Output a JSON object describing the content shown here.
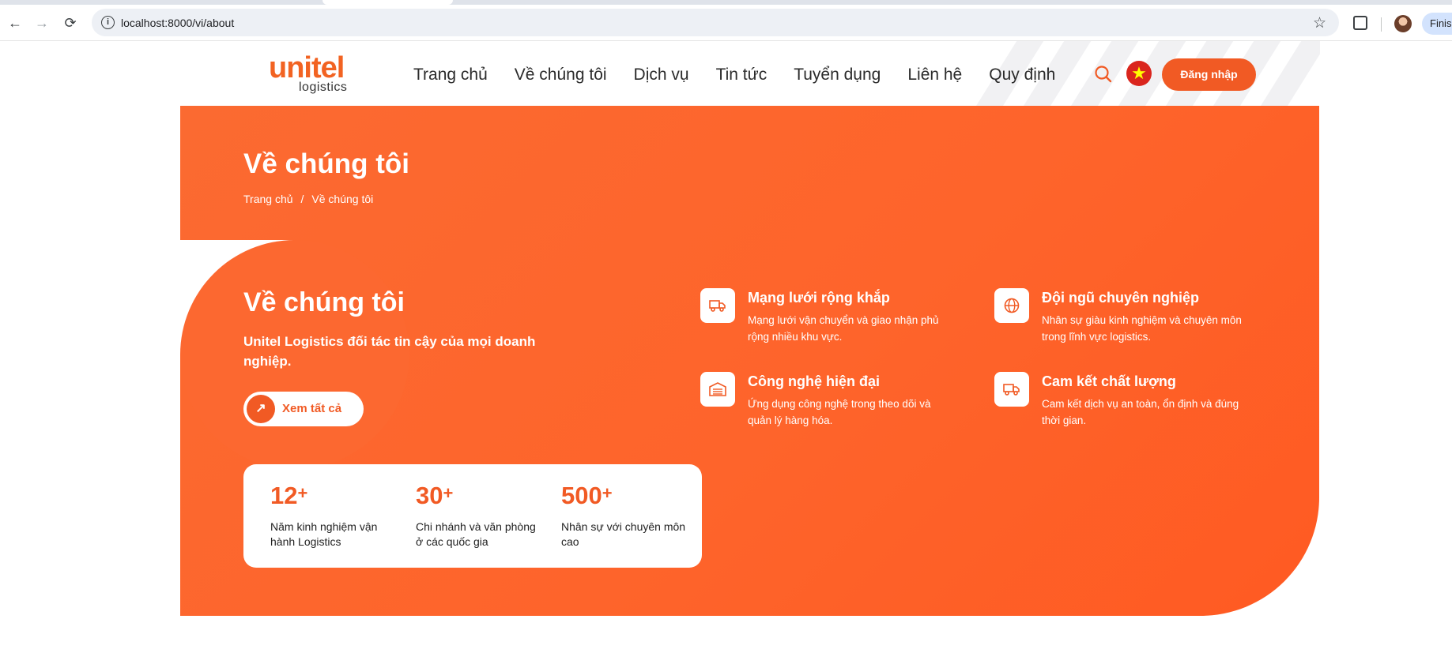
{
  "browser": {
    "url": "localhost:8000/vi/about",
    "profile_pill": "Finish"
  },
  "header": {
    "logo_main": "unitel",
    "logo_sub": "logistics",
    "nav": [
      "Trang chủ",
      "Về chúng tôi",
      "Dịch vụ",
      "Tin tức",
      "Tuyển dụng",
      "Liên hệ",
      "Quy định"
    ],
    "login_label": "Đăng nhập",
    "search_icon": "search-icon",
    "flag_icon": "vietnam-flag-icon"
  },
  "hero": {
    "page_title": "Về chúng tôi",
    "breadcrumb": {
      "home": "Trang chủ",
      "separator": "/",
      "current": "Về chúng tôi"
    },
    "section_title": "Về chúng tôi",
    "section_desc": "Unitel Logistics đối tác tin cậy của mọi doanh nghiệp.",
    "view_all_label": "Xem tất cả"
  },
  "stats": [
    {
      "value": "12",
      "suffix": "+",
      "label": "Năm kinh nghiệm vận hành Logistics"
    },
    {
      "value": "30",
      "suffix": "+",
      "label": "Chi nhánh và văn phòng ở các quốc gia"
    },
    {
      "value": "500",
      "suffix": "+",
      "label": "Nhân sự với chuyên môn cao"
    }
  ],
  "features": [
    {
      "icon": "truck-icon",
      "title": "Mạng lưới rộng khắp",
      "desc": "Mạng lưới vận chuyển và giao nhận phủ rộng nhiều khu vực."
    },
    {
      "icon": "globe-icon",
      "title": "Đội ngũ chuyên nghiệp",
      "desc": "Nhân sự giàu kinh nghiệm và chuyên môn trong lĩnh vực logistics."
    },
    {
      "icon": "warehouse-icon",
      "title": "Công nghệ hiện đại",
      "desc": "Ứng dụng công nghệ trong theo dõi và quản lý hàng hóa."
    },
    {
      "icon": "delivery-truck-icon",
      "title": "Cam kết chất lượng",
      "desc": "Cam kết dịch vụ an toàn, ổn định và đúng thời gian."
    }
  ],
  "colors": {
    "brand_orange": "#f15a24",
    "hero_bg": "#fe642b",
    "text_dark": "#2b2b2b"
  }
}
